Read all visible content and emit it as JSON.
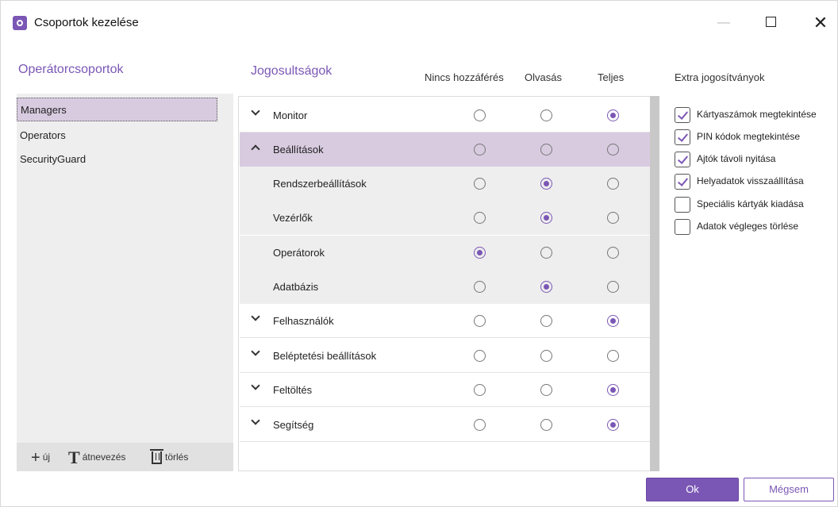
{
  "window": {
    "title": "Csoportok kezelése",
    "minimize_glyph": "—",
    "close_glyph": "✕"
  },
  "groups": {
    "header": "Operátorcsoportok",
    "items": [
      {
        "label": "Managers",
        "selected": true
      },
      {
        "label": "Operators",
        "selected": false
      },
      {
        "label": "SecurityGuard",
        "selected": false
      }
    ],
    "toolbar": {
      "new_glyph": "+",
      "new_label": "új",
      "rename_glyph": "T",
      "rename_label": "átnevezés",
      "delete_label": "törlés"
    }
  },
  "permissions": {
    "header": "Jogosultságok",
    "columns": [
      "Nincs hozzáférés",
      "Olvasás",
      "Teljes"
    ],
    "rows": [
      {
        "label": "Monitor",
        "level": 2,
        "type": "collapsed"
      },
      {
        "label": "Beállítások",
        "level": null,
        "type": "expanded"
      },
      {
        "label": "Rendszerbeállítások",
        "level": 1,
        "type": "sub"
      },
      {
        "label": "Vezérlők",
        "level": 1,
        "type": "sub"
      },
      {
        "label": "Operátorok",
        "level": 0,
        "type": "sub"
      },
      {
        "label": "Adatbázis",
        "level": 1,
        "type": "sub"
      },
      {
        "label": "Felhasználók",
        "level": 2,
        "type": "collapsed"
      },
      {
        "label": "Beléptetési beállítások",
        "level": null,
        "type": "collapsed"
      },
      {
        "label": "Feltöltés",
        "level": 2,
        "type": "collapsed"
      },
      {
        "label": "Segítség",
        "level": 2,
        "type": "collapsed"
      }
    ]
  },
  "extra": {
    "header": "Extra jogosítványok",
    "items": [
      {
        "label": "Kártyaszámok megtekintése",
        "checked": true
      },
      {
        "label": "PIN kódok megtekintése",
        "checked": true
      },
      {
        "label": "Ajtók távoli nyitása",
        "checked": true
      },
      {
        "label": "Helyadatok visszaállítása",
        "checked": true
      },
      {
        "label": "Speciális kártyák kiadása",
        "checked": false
      },
      {
        "label": "Adatok végleges törlése",
        "checked": false
      }
    ]
  },
  "buttons": {
    "ok": "Ok",
    "cancel": "Mégsem"
  },
  "colors": {
    "accent": "#7b57b5",
    "selection": "#d8cbe0"
  }
}
